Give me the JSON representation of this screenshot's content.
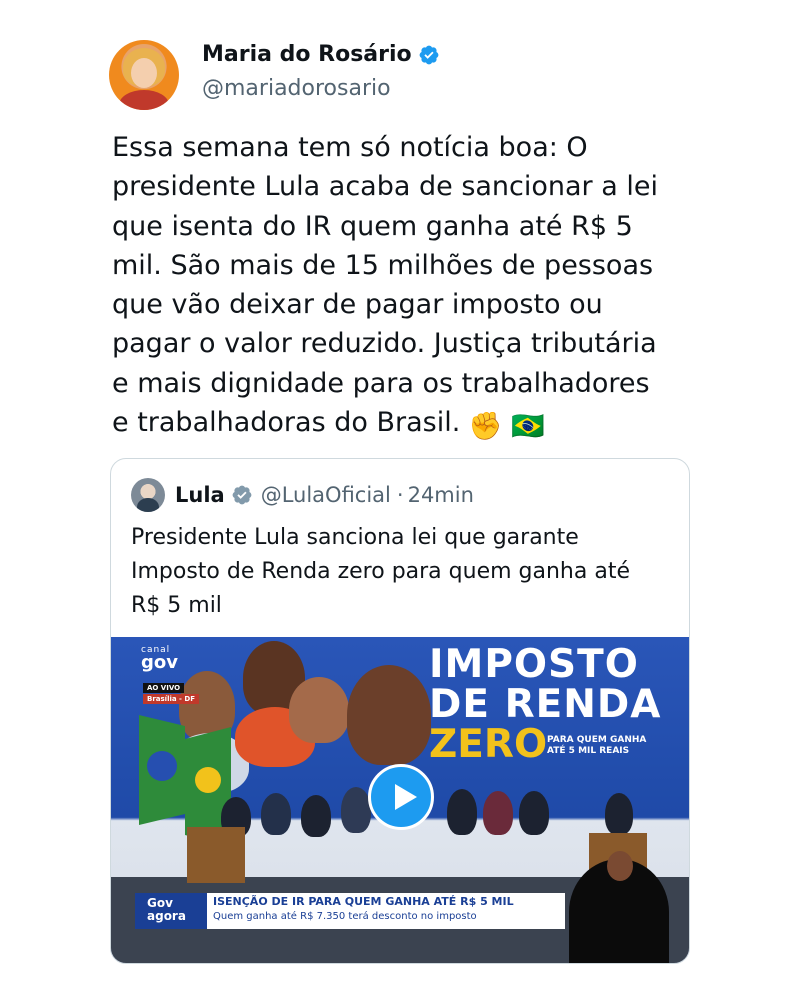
{
  "author": {
    "name": "Maria do Rosário",
    "handle": "@mariadorosario"
  },
  "tweet": {
    "lines": [
      "Essa semana tem só notícia boa: O",
      "presidente Lula acaba de sancionar a lei",
      "que isenta do IR quem ganha até R$ 5",
      "mil. São mais de 15 milhões de pessoas",
      "que vão deixar de pagar imposto ou",
      "pagar o valor reduzido. Justiça tributária",
      "e mais dignidade para os trabalhadores",
      "e trabalhadoras do Brasil."
    ],
    "emojis": [
      "✊",
      "🇧🇷"
    ]
  },
  "quote": {
    "name": "Lula",
    "handle": "@LulaOficial",
    "separator": "·",
    "time": "24min",
    "lines": [
      "Presidente Lula sanciona lei que garante",
      "Imposto de Renda zero para quem ganha até",
      "R$ 5 mil"
    ],
    "media": {
      "channel_top": "canal",
      "channel_name": "gov",
      "live": "AO VIVO",
      "location": "Brasília - DF",
      "headline_1": "IMPOSTO",
      "headline_2": "DE RENDA",
      "headline_3": "ZERO",
      "sub_1": "PARA QUEM GANHA",
      "sub_2": "ATÉ 5 MIL REAIS",
      "bug_1": "Gov",
      "bug_2": "agora",
      "ticker_title": "ISENÇÃO DE IR PARA QUEM GANHA ATÉ R$ 5 MIL",
      "ticker_sub": "Quem ganha até R$ 7.350 terá desconto no imposto"
    }
  },
  "colors": {
    "verified": "#1d9bf0",
    "secondary_text": "#536471",
    "border": "#cfd9de",
    "brand_blue": "#1a3f95",
    "zero_yellow": "#f2c21b"
  }
}
